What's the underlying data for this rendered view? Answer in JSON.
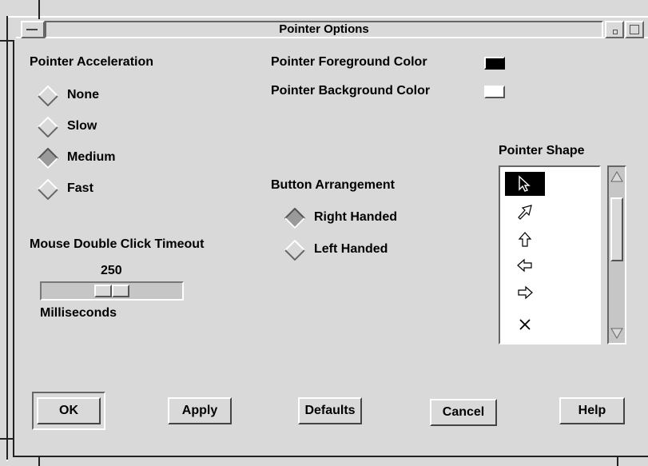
{
  "window": {
    "title": "Pointer Options",
    "menu_icon": "window-menu-icon",
    "minimize_icon": "minimize-icon",
    "maximize_icon": "maximize-icon"
  },
  "acceleration": {
    "label": "Pointer Acceleration",
    "options": [
      "None",
      "Slow",
      "Medium",
      "Fast"
    ],
    "selected": "Medium"
  },
  "double_click": {
    "label": "Mouse Double Click Timeout",
    "value": "250",
    "units": "Milliseconds"
  },
  "colors": {
    "foreground_label": "Pointer Foreground Color",
    "foreground_value": "#000000",
    "background_label": "Pointer Background Color",
    "background_value": "#ffffff"
  },
  "button_arrangement": {
    "label": "Button Arrangement",
    "options": [
      "Right Handed",
      "Left Handed"
    ],
    "selected": "Right Handed"
  },
  "pointer_shape": {
    "label": "Pointer Shape",
    "items": [
      "arrow-pointer-icon",
      "angled-arrow-pointer-icon",
      "up-arrow-pointer-icon",
      "left-arrow-pointer-icon",
      "right-arrow-pointer-icon",
      "x-cursor-icon"
    ],
    "selected_index": 0
  },
  "buttons": {
    "ok": "OK",
    "apply": "Apply",
    "defaults": "Defaults",
    "cancel": "Cancel",
    "help": "Help"
  }
}
